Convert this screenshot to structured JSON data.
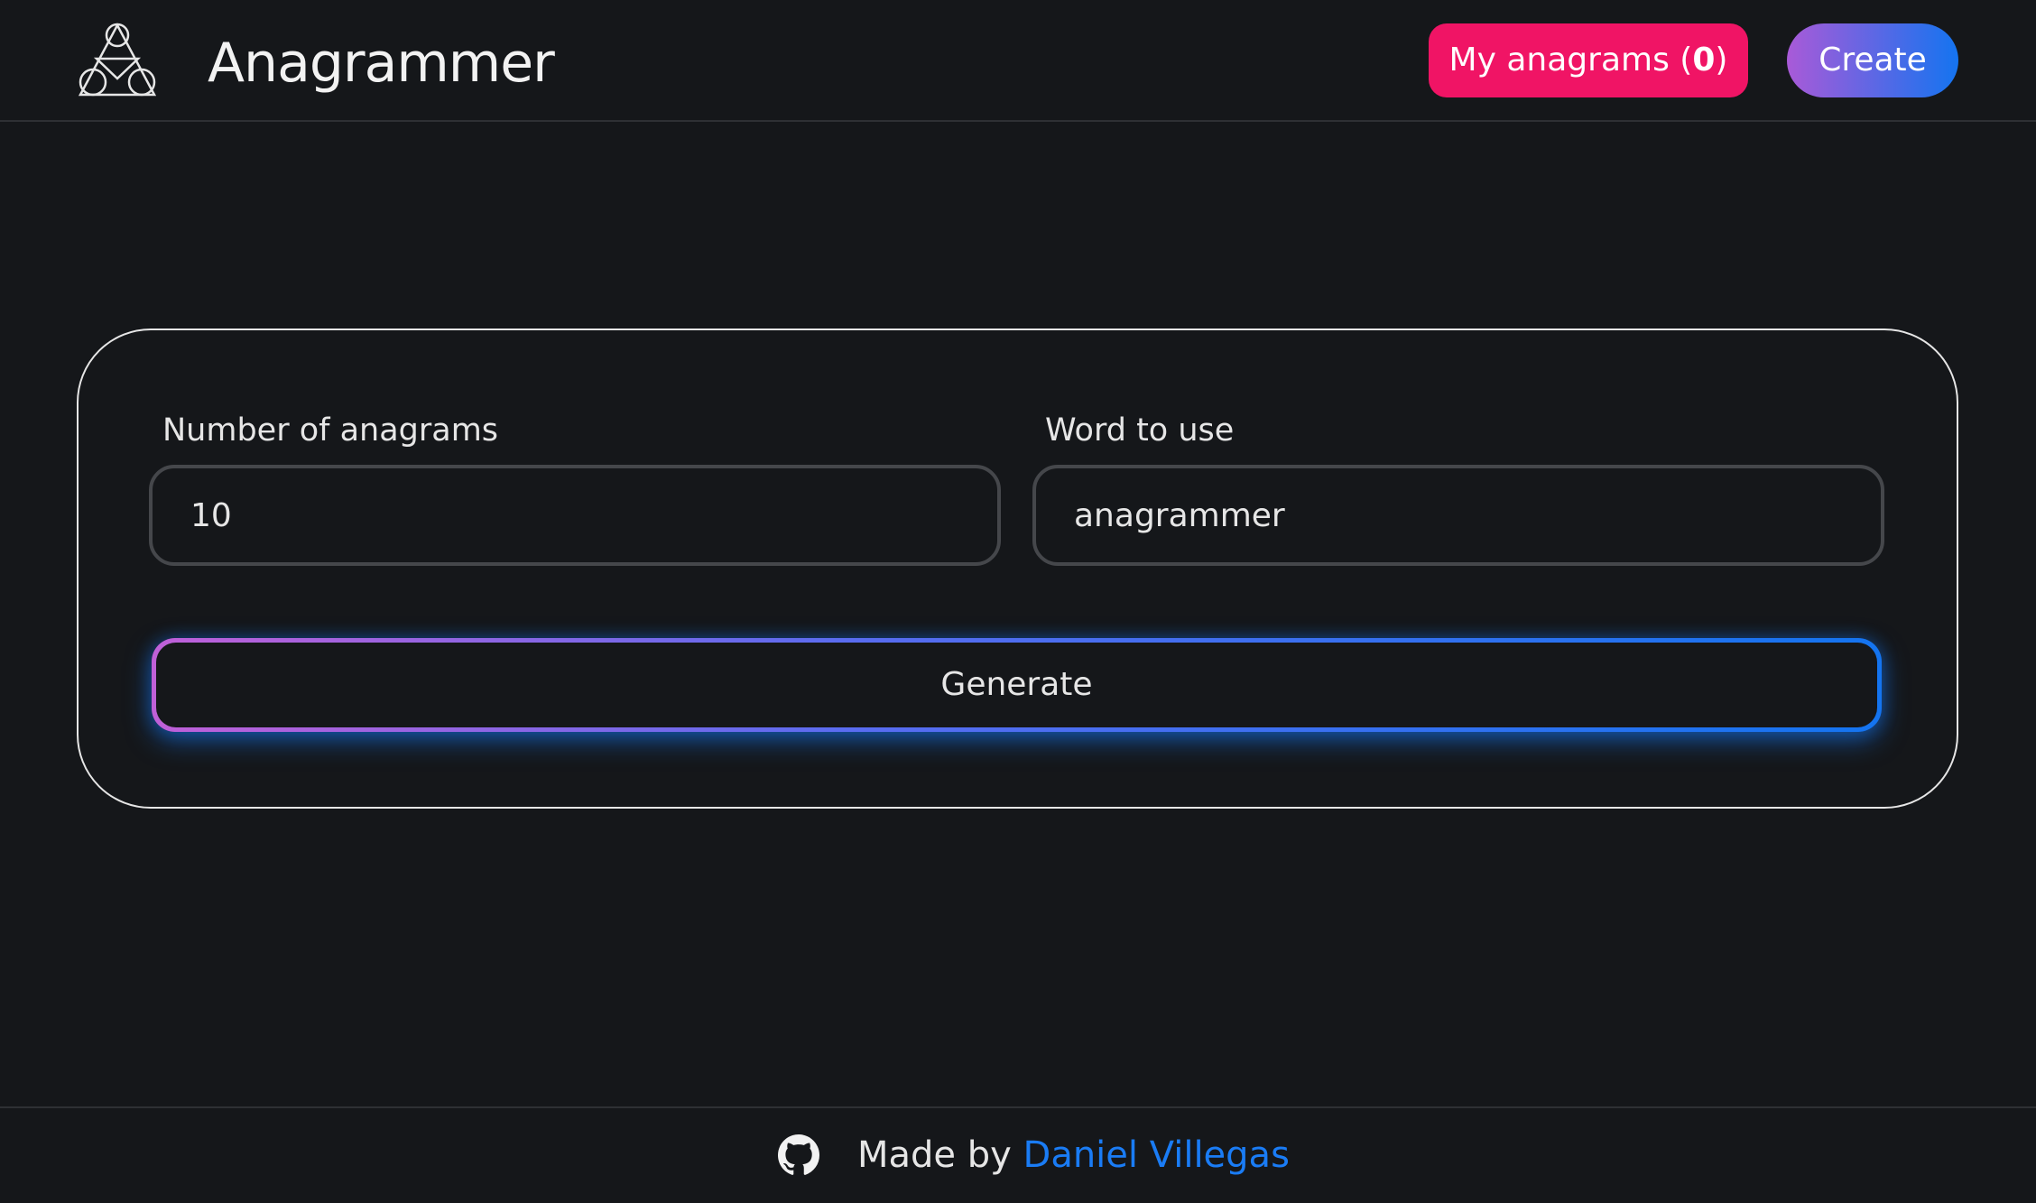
{
  "header": {
    "app_title": "Anagrammer",
    "my_anagrams_label": "My anagrams (",
    "my_anagrams_count": "0",
    "my_anagrams_close": ")",
    "create_label": "Create",
    "logo_icon": "triangle-circles-logo-icon"
  },
  "form": {
    "number_label": "Number of anagrams",
    "number_value": "10",
    "word_label": "Word to use",
    "word_value": "anagrammer",
    "generate_label": "Generate"
  },
  "footer": {
    "github_icon": "github-icon",
    "made_by_label": "Made by ",
    "author_name": "Daniel Villegas"
  },
  "colors": {
    "background": "#15171a",
    "accent_pink": "#f01465",
    "accent_blue": "#1474f0",
    "accent_purple": "#a95ad8",
    "link": "#1a7cf5"
  }
}
